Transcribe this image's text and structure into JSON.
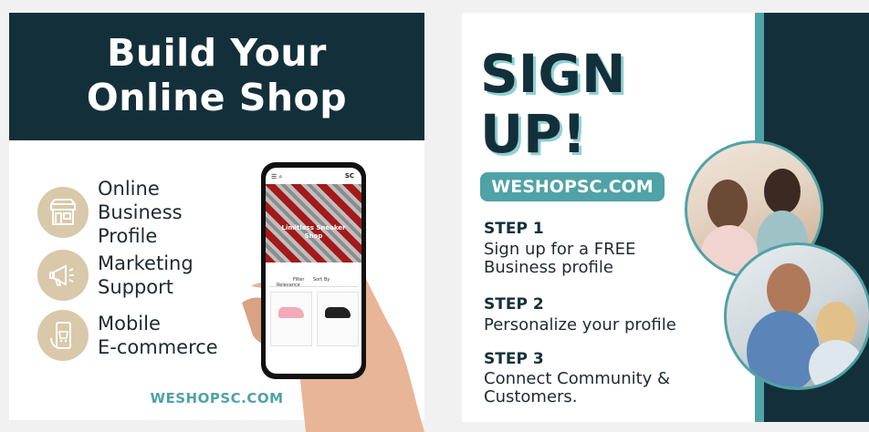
{
  "left": {
    "title_line1": "Build Your",
    "title_line2": "Online Shop",
    "features": [
      {
        "icon": "storefront-icon",
        "text": "Online\nBusiness\nProfile"
      },
      {
        "icon": "megaphone-icon",
        "text": "Marketing\nSupport"
      },
      {
        "icon": "mobile-shop-icon",
        "text": "Mobile\nE-commerce"
      }
    ],
    "url": "WESHOPSC.COM",
    "phone": {
      "logo": "SC",
      "shop_name": "Limitless Sneaker\nShop",
      "filter_labels": [
        "Filter",
        "Sort By",
        "Relevance"
      ]
    }
  },
  "right": {
    "headline": "SIGN\nUP!",
    "url": "WESHOPSC.COM",
    "steps": [
      {
        "title": "STEP 1",
        "text": "Sign up for a FREE\nBusiness profile"
      },
      {
        "title": "STEP 2",
        "text": "Personalize your profile"
      },
      {
        "title": "STEP 3",
        "text": "Connect Community &\nCustomers."
      }
    ]
  },
  "colors": {
    "dark_teal": "#13303a",
    "accent_teal": "#4fa2a6",
    "icon_beige": "#d9c8a9"
  }
}
